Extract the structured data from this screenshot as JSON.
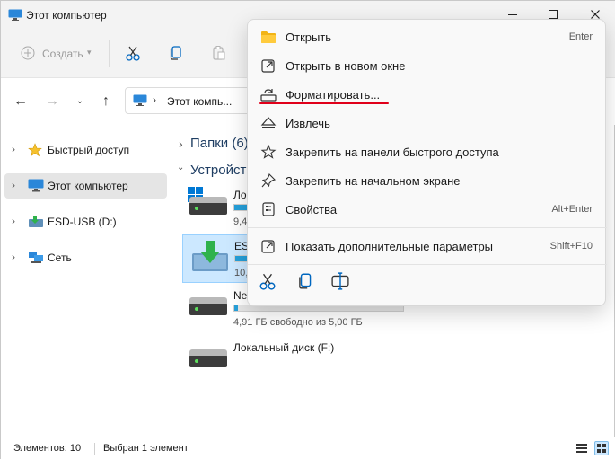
{
  "window": {
    "title": "Этот компьютер",
    "controls": [
      "minimize-icon",
      "maximize-icon",
      "close-icon"
    ]
  },
  "command_bar": {
    "new_label": "Создать",
    "new_icon": "plus-circle-icon",
    "items": [
      "cut-icon",
      "copy-icon",
      "paste-icon"
    ]
  },
  "address_bar": {
    "path_label": "Этот компь..."
  },
  "sidebar": {
    "items": [
      {
        "label": "Быстрый доступ",
        "icon": "star-icon",
        "selected": false
      },
      {
        "label": "Этот компьютер",
        "icon": "computer-icon",
        "selected": true
      },
      {
        "label": "ESD-USB (D:)",
        "icon": "usb-drive-icon",
        "selected": false
      },
      {
        "label": "Сеть",
        "icon": "network-icon",
        "selected": false
      }
    ]
  },
  "content": {
    "folders_header": "Папки (6)",
    "devices_header": "Устройст",
    "drives": [
      {
        "name": "Ло",
        "free": "9,4",
        "fill": 0.6,
        "selected": false,
        "icon": "windows-drive-icon"
      },
      {
        "name": "ESI",
        "free": "10,",
        "fill": 0.3,
        "selected": true,
        "icon": "usb-drive-icon"
      },
      {
        "name": "Ne",
        "free": "4,91 ГБ свободно из 5,00 ГБ",
        "fill": 0.02,
        "selected": false,
        "icon": "hdd-icon"
      },
      {
        "name": "Локальный диск (F:)",
        "free": "",
        "fill": null,
        "selected": false,
        "icon": "hdd-icon"
      }
    ]
  },
  "context_menu": {
    "items": [
      {
        "label": "Открыть",
        "shortcut": "Enter",
        "icon": "folder-icon"
      },
      {
        "label": "Открыть в новом окне",
        "shortcut": "",
        "icon": "open-new-window-icon"
      },
      {
        "label": "Форматировать...",
        "shortcut": "",
        "icon": "format-icon"
      },
      {
        "label": "Извлечь",
        "shortcut": "",
        "icon": "eject-icon"
      },
      {
        "label": "Закрепить на панели быстрого доступа",
        "shortcut": "",
        "icon": "pin-star-icon"
      },
      {
        "label": "Закрепить на начальном экране",
        "shortcut": "",
        "icon": "pin-icon"
      },
      {
        "label": "Свойства",
        "shortcut": "Alt+Enter",
        "icon": "properties-icon"
      },
      {
        "label": "Показать дополнительные параметры",
        "shortcut": "Shift+F10",
        "icon": "more-options-icon"
      }
    ],
    "quick_actions": [
      "cut-icon",
      "copy-icon",
      "rename-icon"
    ]
  },
  "status_bar": {
    "items_count": "Элементов: 10",
    "selected": "Выбран 1 элемент"
  },
  "colors": {
    "accent": "#0078d4",
    "selection_bg": "#cce8ff",
    "annotation_red": "#e0001a",
    "bar_fill": "#26a0da"
  }
}
